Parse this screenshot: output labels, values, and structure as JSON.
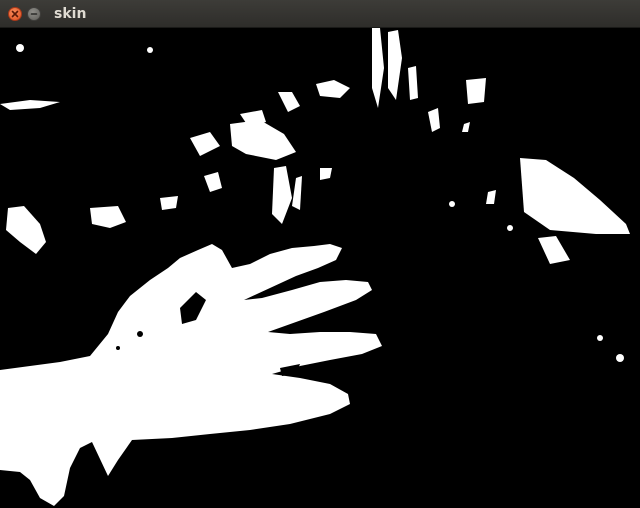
{
  "window": {
    "title": "skin"
  },
  "controls": {
    "close_icon": "close-icon",
    "minimize_icon": "minimize-icon"
  },
  "colors": {
    "mask_foreground": "#ffffff",
    "mask_background": "#000000",
    "close_button": "#e8582a",
    "titlebar": "#353430"
  }
}
